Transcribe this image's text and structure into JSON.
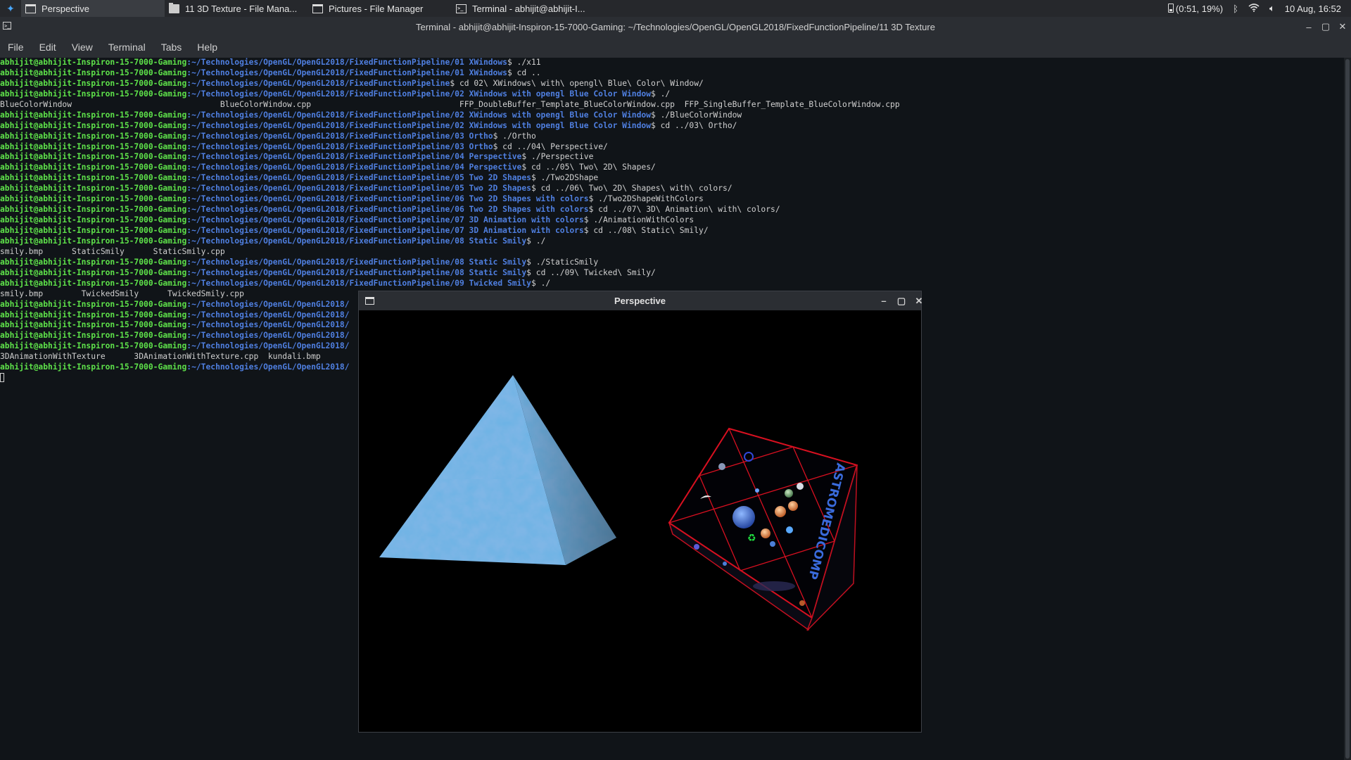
{
  "panel": {
    "tasks": [
      {
        "label": "Perspective",
        "icon": "window-icon",
        "active": true
      },
      {
        "label": "11 3D Texture - File Mana...",
        "icon": "folder-icon",
        "active": false
      },
      {
        "label": "Pictures - File Manager",
        "icon": "window-icon",
        "active": false
      },
      {
        "label": "Terminal - abhijit@abhijit-I...",
        "icon": "terminal-icon",
        "active": false
      }
    ],
    "battery": "(0:51, 19%)",
    "clock": "10 Aug, 16:52"
  },
  "terminal": {
    "title": "Terminal - abhijit@abhijit-Inspiron-15-7000-Gaming: ~/Technologies/OpenGL/OpenGL2018/FixedFunctionPipeline/11 3D Texture",
    "menu": [
      "File",
      "Edit",
      "View",
      "Terminal",
      "Tabs",
      "Help"
    ],
    "prompt_user": "abhijit@abhijit-Inspiron-15-7000-Gaming",
    "lines": [
      {
        "t": "p",
        "path": ":~/Technologies/OpenGL/OpenGL2018/FixedFunctionPipeline/01 XWindows",
        "cmd": "$ ./x11"
      },
      {
        "t": "p",
        "path": ":~/Technologies/OpenGL/OpenGL2018/FixedFunctionPipeline/01 XWindows",
        "cmd": "$ cd .."
      },
      {
        "t": "p",
        "path": ":~/Technologies/OpenGL/OpenGL2018/FixedFunctionPipeline",
        "cmd": "$ cd 02\\ XWindows\\ with\\ opengl\\ Blue\\ Color\\ Window/"
      },
      {
        "t": "p",
        "path": ":~/Technologies/OpenGL/OpenGL2018/FixedFunctionPipeline/02 XWindows with opengl Blue Color Window",
        "cmd": "$ ./"
      },
      {
        "t": "o",
        "text": "BlueColorWindow                               BlueColorWindow.cpp                               FFP_DoubleBuffer_Template_BlueColorWindow.cpp  FFP_SingleBuffer_Template_BlueColorWindow.cpp"
      },
      {
        "t": "p",
        "path": ":~/Technologies/OpenGL/OpenGL2018/FixedFunctionPipeline/02 XWindows with opengl Blue Color Window",
        "cmd": "$ ./BlueColorWindow"
      },
      {
        "t": "p",
        "path": ":~/Technologies/OpenGL/OpenGL2018/FixedFunctionPipeline/02 XWindows with opengl Blue Color Window",
        "cmd": "$ cd ../03\\ Ortho/"
      },
      {
        "t": "p",
        "path": ":~/Technologies/OpenGL/OpenGL2018/FixedFunctionPipeline/03 Ortho",
        "cmd": "$ ./Ortho"
      },
      {
        "t": "p",
        "path": ":~/Technologies/OpenGL/OpenGL2018/FixedFunctionPipeline/03 Ortho",
        "cmd": "$ cd ../04\\ Perspective/"
      },
      {
        "t": "p",
        "path": ":~/Technologies/OpenGL/OpenGL2018/FixedFunctionPipeline/04 Perspective",
        "cmd": "$ ./Perspective"
      },
      {
        "t": "p",
        "path": ":~/Technologies/OpenGL/OpenGL2018/FixedFunctionPipeline/04 Perspective",
        "cmd": "$ cd ../05\\ Two\\ 2D\\ Shapes/"
      },
      {
        "t": "p",
        "path": ":~/Technologies/OpenGL/OpenGL2018/FixedFunctionPipeline/05 Two 2D Shapes",
        "cmd": "$ ./Two2DShape"
      },
      {
        "t": "p",
        "path": ":~/Technologies/OpenGL/OpenGL2018/FixedFunctionPipeline/05 Two 2D Shapes",
        "cmd": "$ cd ../06\\ Two\\ 2D\\ Shapes\\ with\\ colors/"
      },
      {
        "t": "p",
        "path": ":~/Technologies/OpenGL/OpenGL2018/FixedFunctionPipeline/06 Two 2D Shapes with colors",
        "cmd": "$ ./Two2DShapeWithColors"
      },
      {
        "t": "p",
        "path": ":~/Technologies/OpenGL/OpenGL2018/FixedFunctionPipeline/06 Two 2D Shapes with colors",
        "cmd": "$ cd ../07\\ 3D\\ Animation\\ with\\ colors/"
      },
      {
        "t": "p",
        "path": ":~/Technologies/OpenGL/OpenGL2018/FixedFunctionPipeline/07 3D Animation with colors",
        "cmd": "$ ./AnimationWithColors"
      },
      {
        "t": "p",
        "path": ":~/Technologies/OpenGL/OpenGL2018/FixedFunctionPipeline/07 3D Animation with colors",
        "cmd": "$ cd ../08\\ Static\\ Smily/"
      },
      {
        "t": "p",
        "path": ":~/Technologies/OpenGL/OpenGL2018/FixedFunctionPipeline/08 Static Smily",
        "cmd": "$ ./"
      },
      {
        "t": "o",
        "text": "smily.bmp      StaticSmily      StaticSmily.cpp"
      },
      {
        "t": "p",
        "path": ":~/Technologies/OpenGL/OpenGL2018/FixedFunctionPipeline/08 Static Smily",
        "cmd": "$ ./StaticSmily"
      },
      {
        "t": "p",
        "path": ":~/Technologies/OpenGL/OpenGL2018/FixedFunctionPipeline/08 Static Smily",
        "cmd": "$ cd ../09\\ Twicked\\ Smily/"
      },
      {
        "t": "p",
        "path": ":~/Technologies/OpenGL/OpenGL2018/FixedFunctionPipeline/09 Twicked Smily",
        "cmd": "$ ./"
      },
      {
        "t": "o",
        "text": "smily.bmp        TwickedSmily      TwickedSmily.cpp"
      },
      {
        "t": "p",
        "path": ":~/Technologies/OpenGL/OpenGL2018/",
        "cmd": ""
      },
      {
        "t": "p",
        "path": ":~/Technologies/OpenGL/OpenGL2018/",
        "cmd": ""
      },
      {
        "t": "p",
        "path": ":~/Technologies/OpenGL/OpenGL2018/",
        "cmd": ""
      },
      {
        "t": "p",
        "path": ":~/Technologies/OpenGL/OpenGL2018/",
        "cmd": ""
      },
      {
        "t": "p",
        "path": ":~/Technologies/OpenGL/OpenGL2018/",
        "cmd": ""
      },
      {
        "t": "o",
        "text": "3DAnimationWithTexture      3DAnimationWithTexture.cpp  kundali.bmp"
      },
      {
        "t": "p",
        "path": ":~/Technologies/OpenGL/OpenGL2018/",
        "cmd": ""
      }
    ]
  },
  "perspective": {
    "title": "Perspective",
    "cube_text": "ASTROMEDICOMP"
  }
}
